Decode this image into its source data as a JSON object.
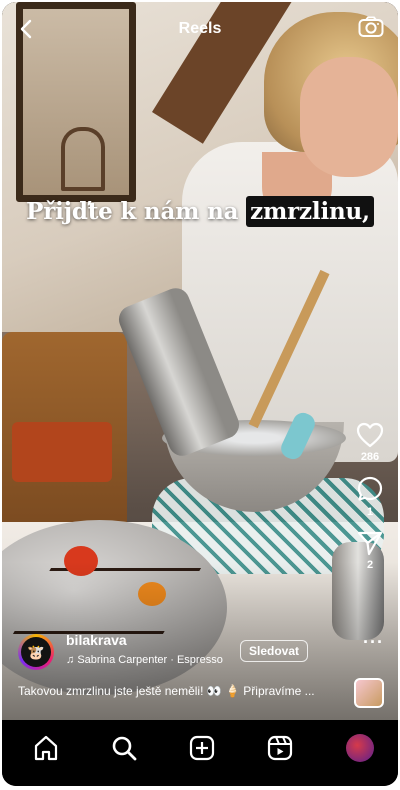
{
  "header": {
    "title": "Reels",
    "back_icon": "back-icon",
    "camera_icon": "camera-icon"
  },
  "caption_overlay": {
    "part_a": "Přijďte k nám na",
    "part_b": "zmrzlinu,"
  },
  "actions": {
    "like_count": "286",
    "comment_count": "1",
    "share_count": "2",
    "like_icon": "heart-icon",
    "comment_icon": "comment-icon",
    "share_icon": "share-icon",
    "more_icon": "more-icon",
    "more_label": "···"
  },
  "post": {
    "username": "bilakrava",
    "music_note_icon": "music-note-icon",
    "audio": "Sabrina Carpenter · Espresso",
    "follow_label": "Sledovat",
    "description": "Takovou zmrzlinu jste ještě neměli! 👀 🍦 Připravíme ..."
  },
  "nav": {
    "items": [
      {
        "icon": "home-icon"
      },
      {
        "icon": "search-icon"
      },
      {
        "icon": "create-icon"
      },
      {
        "icon": "reels-icon"
      },
      {
        "icon": "profile-avatar"
      }
    ]
  },
  "colors": {
    "background": "#000000",
    "text": "#ffffff",
    "caption_highlight": "#111111"
  }
}
